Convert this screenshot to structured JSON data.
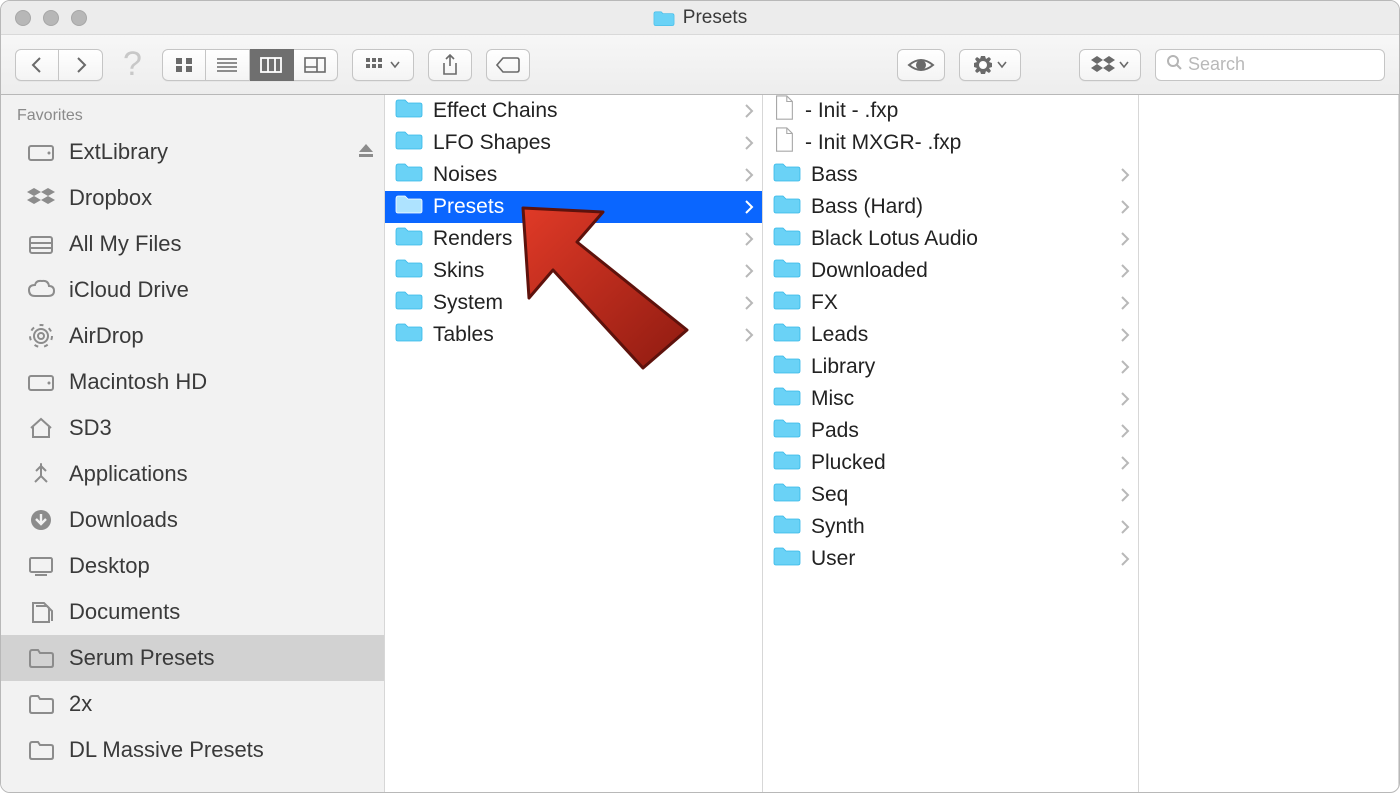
{
  "window": {
    "title": "Presets"
  },
  "toolbar": {
    "search_placeholder": "Search"
  },
  "sidebar": {
    "heading": "Favorites",
    "items": [
      {
        "label": "ExtLibrary",
        "icon": "hdd",
        "eject": true,
        "selected": false
      },
      {
        "label": "Dropbox",
        "icon": "dropbox",
        "eject": false,
        "selected": false
      },
      {
        "label": "All My Files",
        "icon": "allfiles",
        "eject": false,
        "selected": false
      },
      {
        "label": "iCloud Drive",
        "icon": "cloud",
        "eject": false,
        "selected": false
      },
      {
        "label": "AirDrop",
        "icon": "airdrop",
        "eject": false,
        "selected": false
      },
      {
        "label": "Macintosh HD",
        "icon": "hdd",
        "eject": false,
        "selected": false
      },
      {
        "label": "SD3",
        "icon": "home",
        "eject": false,
        "selected": false
      },
      {
        "label": "Applications",
        "icon": "apps",
        "eject": false,
        "selected": false
      },
      {
        "label": "Downloads",
        "icon": "download",
        "eject": false,
        "selected": false
      },
      {
        "label": "Desktop",
        "icon": "desktop",
        "eject": false,
        "selected": false
      },
      {
        "label": "Documents",
        "icon": "docs",
        "eject": false,
        "selected": false
      },
      {
        "label": "Serum Presets",
        "icon": "folder-g",
        "eject": false,
        "selected": true
      },
      {
        "label": "2x",
        "icon": "folder-g",
        "eject": false,
        "selected": false
      },
      {
        "label": "DL Massive Presets",
        "icon": "folder-g",
        "eject": false,
        "selected": false
      }
    ]
  },
  "column1": [
    {
      "label": "Effect Chains",
      "type": "folder",
      "children": true,
      "selected": false
    },
    {
      "label": "LFO Shapes",
      "type": "folder",
      "children": true,
      "selected": false
    },
    {
      "label": "Noises",
      "type": "folder",
      "children": true,
      "selected": false
    },
    {
      "label": "Presets",
      "type": "folder",
      "children": true,
      "selected": true
    },
    {
      "label": "Renders",
      "type": "folder",
      "children": true,
      "selected": false
    },
    {
      "label": "Skins",
      "type": "folder",
      "children": true,
      "selected": false
    },
    {
      "label": "System",
      "type": "folder",
      "children": true,
      "selected": false
    },
    {
      "label": "Tables",
      "type": "folder",
      "children": true,
      "selected": false
    }
  ],
  "column2": [
    {
      "label": " - Init - .fxp",
      "type": "file",
      "children": false
    },
    {
      "label": " - Init MXGR- .fxp",
      "type": "file",
      "children": false
    },
    {
      "label": "Bass",
      "type": "folder",
      "children": true
    },
    {
      "label": "Bass (Hard)",
      "type": "folder",
      "children": true
    },
    {
      "label": "Black Lotus Audio",
      "type": "folder",
      "children": true
    },
    {
      "label": "Downloaded",
      "type": "folder",
      "children": true
    },
    {
      "label": "FX",
      "type": "folder",
      "children": true
    },
    {
      "label": "Leads",
      "type": "folder",
      "children": true
    },
    {
      "label": "Library",
      "type": "folder",
      "children": true
    },
    {
      "label": "Misc",
      "type": "folder",
      "children": true
    },
    {
      "label": "Pads",
      "type": "folder",
      "children": true
    },
    {
      "label": "Plucked",
      "type": "folder",
      "children": true
    },
    {
      "label": "Seq",
      "type": "folder",
      "children": true
    },
    {
      "label": "Synth",
      "type": "folder",
      "children": true
    },
    {
      "label": "User",
      "type": "folder",
      "children": true
    }
  ],
  "colors": {
    "accent": "#0a66ff",
    "folder": "#6ad2f6",
    "folderDark": "#35b8e8"
  }
}
